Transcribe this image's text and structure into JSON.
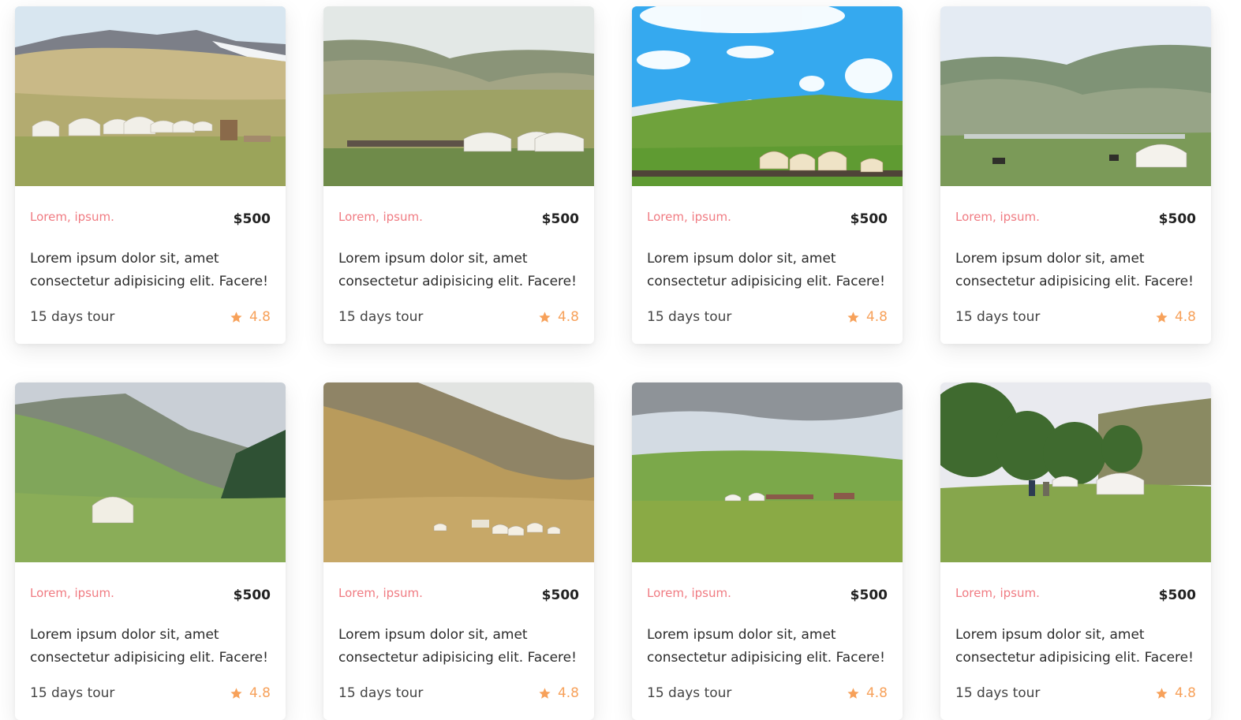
{
  "colors": {
    "category": "#f07b82",
    "rating": "#f7a15a",
    "price": "#222222"
  },
  "tours": [
    {
      "category": "Lorem, ipsum.",
      "price": "$500",
      "title": "Lorem ipsum dolor sit, amet consectetur adipisicing elit. Facere!",
      "duration": "15 days tour",
      "rating": "4.8",
      "icon": "star-icon",
      "scene": "steppe-yurt-camp-snowy-ridge"
    },
    {
      "category": "Lorem, ipsum.",
      "price": "$500",
      "title": "Lorem ipsum dolor sit, amet consectetur adipisicing elit. Facere!",
      "duration": "15 days tour",
      "rating": "4.8",
      "icon": "star-icon",
      "scene": "grassland-yurts-fence-hills"
    },
    {
      "category": "Lorem, ipsum.",
      "price": "$500",
      "title": "Lorem ipsum dolor sit, amet consectetur adipisicing elit. Facere!",
      "duration": "15 days tour",
      "rating": "4.8",
      "icon": "star-icon",
      "scene": "blue-sky-yurts-green-meadow"
    },
    {
      "category": "Lorem, ipsum.",
      "price": "$500",
      "title": "Lorem ipsum dolor sit, amet consectetur adipisicing elit. Facere!",
      "duration": "15 days tour",
      "rating": "4.8",
      "icon": "star-icon",
      "scene": "valley-yurt-horses"
    },
    {
      "category": "Lorem, ipsum.",
      "price": "$500",
      "title": "Lorem ipsum dolor sit, amet consectetur adipisicing elit. Facere!",
      "duration": "15 days tour",
      "rating": "4.8",
      "icon": "star-icon",
      "scene": "mountain-valley-single-yurt"
    },
    {
      "category": "Lorem, ipsum.",
      "price": "$500",
      "title": "Lorem ipsum dolor sit, amet consectetur adipisicing elit. Facere!",
      "duration": "15 days tour",
      "rating": "4.8",
      "icon": "star-icon",
      "scene": "golden-slope-yurt-cluster"
    },
    {
      "category": "Lorem, ipsum.",
      "price": "$500",
      "title": "Lorem ipsum dolor sit, amet consectetur adipisicing elit. Facere!",
      "duration": "15 days tour",
      "rating": "4.8",
      "icon": "star-icon",
      "scene": "cloudy-green-plain-yurts"
    },
    {
      "category": "Lorem, ipsum.",
      "price": "$500",
      "title": "Lorem ipsum dolor sit, amet consectetur adipisicing elit. Facere!",
      "duration": "15 days tour",
      "rating": "4.8",
      "icon": "star-icon",
      "scene": "forest-meadow-yurts-hikers"
    }
  ]
}
